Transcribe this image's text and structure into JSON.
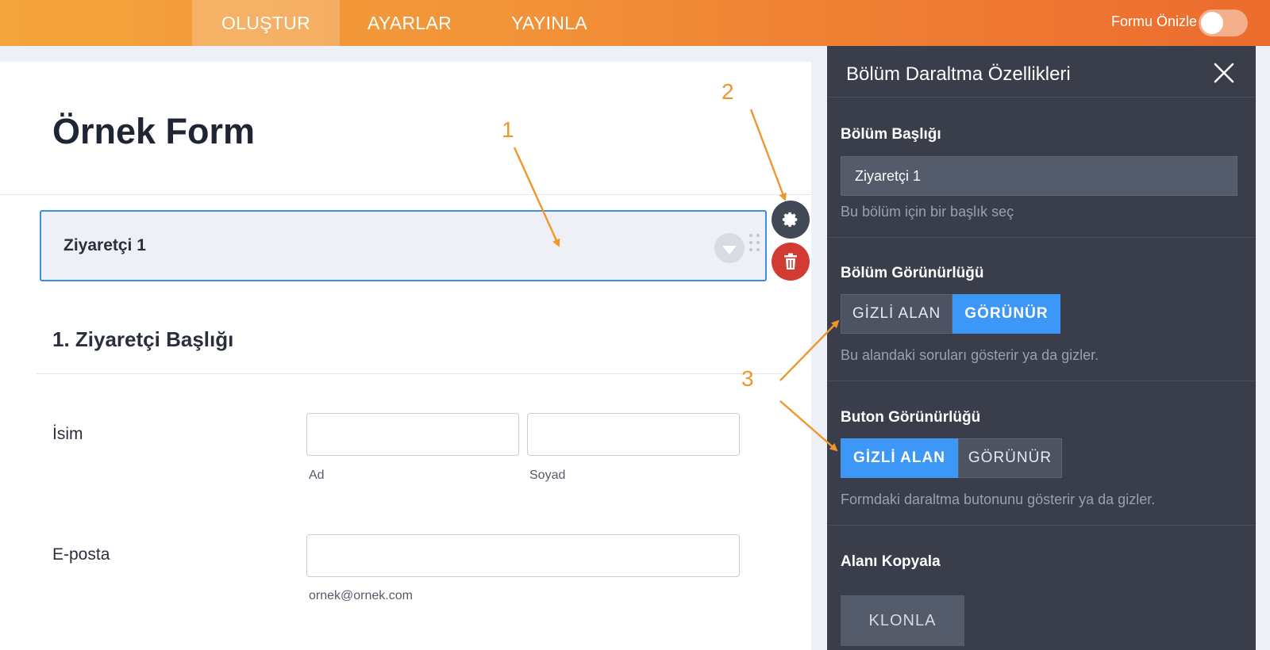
{
  "topbar": {
    "tabs": [
      {
        "label": "OLUŞTUR",
        "active": true
      },
      {
        "label": "AYARLAR",
        "active": false
      },
      {
        "label": "YAYINLA",
        "active": false
      }
    ],
    "preview_label": "Formu Önizle",
    "preview_on": false
  },
  "form": {
    "title": "Örnek Form",
    "section_title": "Ziyaretçi 1",
    "heading": "1. Ziyaretçi Başlığı",
    "name_field": {
      "label": "İsim",
      "first_sublabel": "Ad",
      "last_sublabel": "Soyad"
    },
    "email_field": {
      "label": "E-posta",
      "sublabel": "ornek@ornek.com"
    }
  },
  "panel": {
    "title": "Bölüm Daraltma Özellikleri",
    "section_title": {
      "label": "Bölüm Başlığı",
      "value": "Ziyaretçi 1",
      "help": "Bu bölüm için bir başlık seç"
    },
    "section_visibility": {
      "label": "Bölüm Görünürlüğü",
      "hidden_label": "GİZLİ ALAN",
      "visible_label": "GÖRÜNÜR",
      "selected": "GÖRÜNÜR",
      "help": "Bu alandaki soruları gösterir ya da gizler."
    },
    "button_visibility": {
      "label": "Buton Görünürlüğü",
      "hidden_label": "GİZLİ ALAN",
      "visible_label": "GÖRÜNÜR",
      "selected": "GİZLİ ALAN",
      "help": "Formdaki daraltma butonunu gösterir ya da gizler."
    },
    "duplicate": {
      "label": "Alanı Kopyala",
      "button": "KLONLA"
    }
  },
  "annotations": [
    "1",
    "2",
    "3"
  ],
  "colors": {
    "accent": "#3c97f6",
    "annotation": "#f0962c",
    "danger": "#d23b32",
    "panel": "#393e4a"
  }
}
